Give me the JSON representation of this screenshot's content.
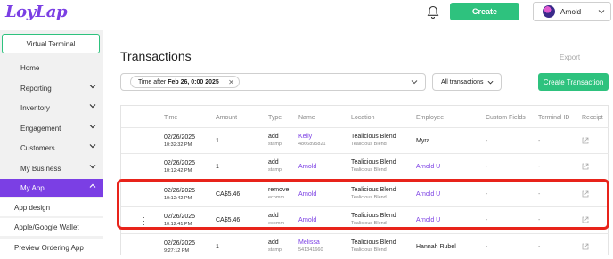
{
  "brand": {
    "logo_text": "LoyLap",
    "accent": "#7b3fe4",
    "green": "#2ec27e"
  },
  "topbar": {
    "create_label": "Create",
    "user_name": "Arnold"
  },
  "sidebar": {
    "virtual_terminal": "Virtual Terminal",
    "items": [
      {
        "label": "Home",
        "chevron": false
      },
      {
        "label": "Reporting",
        "chevron": true
      },
      {
        "label": "Inventory",
        "chevron": true
      },
      {
        "label": "Engagement",
        "chevron": true
      },
      {
        "label": "Customers",
        "chevron": true
      },
      {
        "label": "My Business",
        "chevron": true
      },
      {
        "label": "My App",
        "chevron": true,
        "active": true
      }
    ],
    "subitems": [
      "App design",
      "Apple/Google Wallet",
      "Preview Ordering App"
    ]
  },
  "main": {
    "title": "Transactions",
    "export_label": "Export",
    "filter": {
      "chip_prefix": "Time after",
      "chip_value": "Feb 26, 0:00 2025"
    },
    "type_select": "All transactions",
    "create_transaction": "Create Transaction"
  },
  "table": {
    "headers": [
      "Time",
      "Amount",
      "Type",
      "Name",
      "Location",
      "Employee",
      "Custom Fields",
      "Terminal ID",
      "Receipt"
    ],
    "rows": [
      {
        "date": "02/26/2025",
        "time": "10:32:32 PM",
        "amount": "1",
        "type": "add",
        "type_sub": "stamp",
        "name": "Kelly",
        "name_sub": "4866895821",
        "location": "Tealicious Blend",
        "location_sub": "Tealicious Blend",
        "employee": "Myra",
        "employee_link": false,
        "custom": "-",
        "terminal": "-"
      },
      {
        "date": "02/26/2025",
        "time": "10:12:42 PM",
        "amount": "1",
        "type": "add",
        "type_sub": "stamp",
        "name": "Arnold",
        "name_sub": "",
        "location": "Tealicious Blend",
        "location_sub": "Tealicious Blend",
        "employee": "Arnold U",
        "employee_link": true,
        "custom": "-",
        "terminal": "-"
      },
      {
        "date": "02/26/2025",
        "time": "10:12:42 PM",
        "amount": "CA$5.46",
        "type": "remove",
        "type_sub": "ecomm",
        "name": "Arnold",
        "name_sub": "",
        "location": "Tealicious Blend",
        "location_sub": "Tealicious Blend",
        "employee": "Arnold U",
        "employee_link": true,
        "custom": "-",
        "terminal": "-"
      },
      {
        "date": "02/26/2025",
        "time": "10:12:41 PM",
        "amount": "CA$5.46",
        "type": "add",
        "type_sub": "ecomm",
        "name": "Arnold",
        "name_sub": "",
        "location": "Tealicious Blend",
        "location_sub": "Tealicious Blend",
        "employee": "Arnold U",
        "employee_link": true,
        "custom": "-",
        "terminal": "-"
      },
      {
        "date": "02/26/2025",
        "time": "9:27:12 PM",
        "amount": "1",
        "type": "add",
        "type_sub": "stamp",
        "name": "Melissa",
        "name_sub": "541341660",
        "location": "Tealicious Blend",
        "location_sub": "Tealicious Blend",
        "employee": "Hannah Rubel",
        "employee_link": false,
        "custom": "-",
        "terminal": "-"
      }
    ]
  },
  "icons": [
    "bell-icon",
    "chevron-down-icon",
    "close-icon",
    "external-link-icon",
    "kebab-menu-icon",
    "avatar"
  ]
}
